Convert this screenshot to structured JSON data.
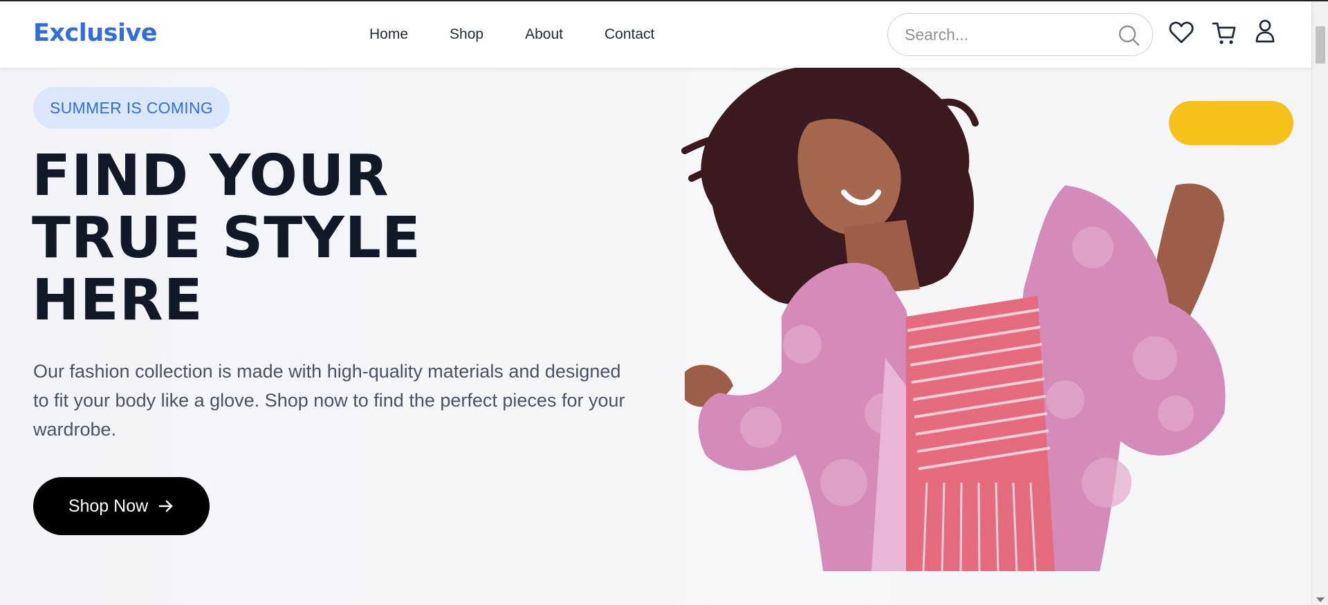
{
  "header": {
    "logo": "Exclusive",
    "nav": [
      "Home",
      "Shop",
      "About",
      "Contact"
    ],
    "search_placeholder": "Search...",
    "icons": [
      "search-icon",
      "heart-icon",
      "cart-icon",
      "user-icon"
    ]
  },
  "hero": {
    "badge": "SUMMER IS COMING",
    "headline": [
      "FIND YOUR",
      "TRUE STYLE",
      "HERE"
    ],
    "description": "Our fashion collection is made with high-quality materials and designed to fit your body like a glove. Shop now to find the perfect pieces for your wardrobe.",
    "cta_label": "Shop Now",
    "image": "woman in pink fluffy coat and striped dress"
  },
  "colors": {
    "brand": "#2f6de1",
    "badge_bg": "#dbe7fd",
    "headline": "#121826",
    "cta_bg": "#000000",
    "accent_yellow": "#f6c21a"
  }
}
